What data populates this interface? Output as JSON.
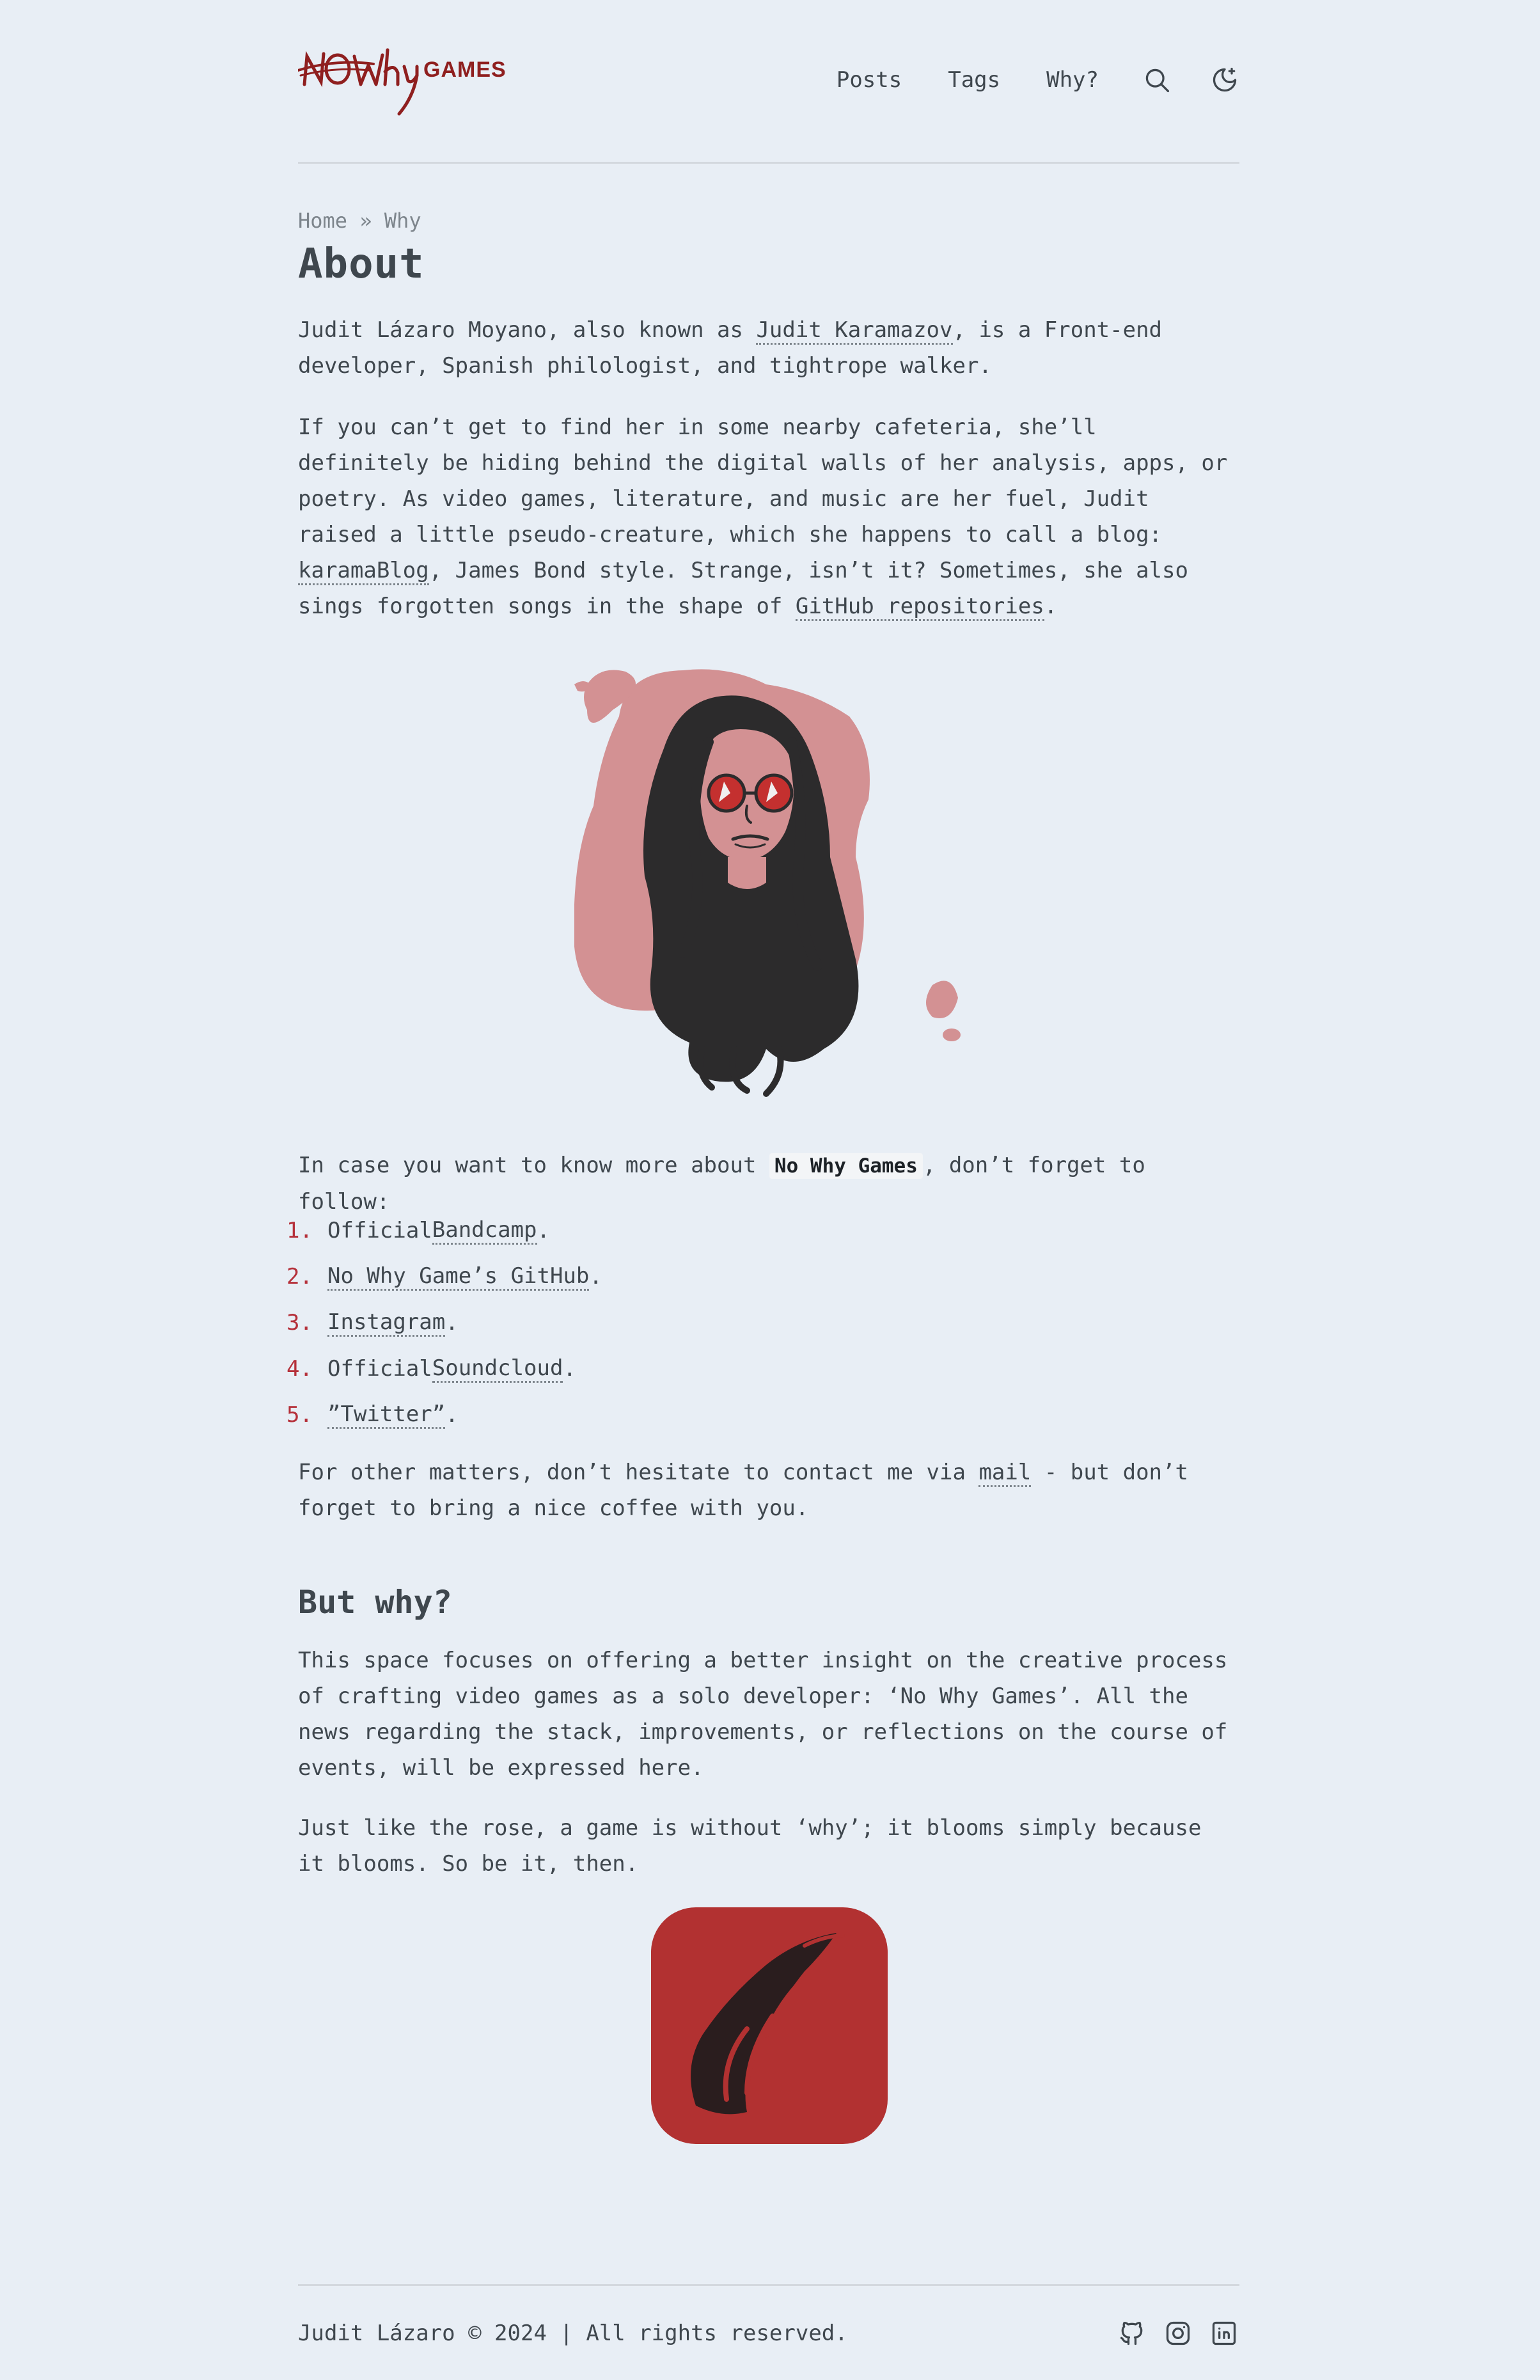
{
  "site": {
    "logo_games": "GAMES",
    "nav": [
      "Posts",
      "Tags",
      "Why?"
    ],
    "icons": {
      "search": "search-icon",
      "theme": "moon-sparkle-icon"
    },
    "accent": "#8f1f1f"
  },
  "breadcrumb": {
    "home": "Home",
    "sep": "»",
    "current": "Why"
  },
  "page_title": "About",
  "intro": {
    "p1_before": "Judit Lázaro Moyano, also known as ",
    "p1_link": "Judit Karamazov",
    "p1_after": ", is a Front-end developer, Spanish philologist, and tightrope walker.",
    "p2_before": "If you can’t get to find her in some nearby cafeteria, she’ll definitely be hiding behind the digital walls of her analysis, apps, or poetry. As video games, literature, and music are her fuel, Judit raised a little pseudo-creature, which she happens to call a blog: ",
    "p2_link1": "karamaBlog",
    "p2_mid": ", James Bond style. Strange, isn’t it? Sometimes, she also sings forgotten songs in the shape of ",
    "p2_link2": "GitHub repositories",
    "p2_after": "."
  },
  "follow": {
    "before": "In case you want to know more about ",
    "chip": "No Why Games",
    "after": ", don’t forget to follow:",
    "items": [
      {
        "num": "1.",
        "pre": "Official ",
        "link": "Bandcamp",
        "post": "."
      },
      {
        "num": "2.",
        "pre": "",
        "link": "No Why Game’s GitHub",
        "post": "."
      },
      {
        "num": "3.",
        "pre": "",
        "link": "Instagram",
        "post": "."
      },
      {
        "num": "4.",
        "pre": "Official ",
        "link": "Soundcloud",
        "post": "."
      },
      {
        "num": "5.",
        "pre": "",
        "link": "”Twitter”",
        "post": "."
      }
    ]
  },
  "contact": {
    "before": "For other matters, don’t hesitate to contact me via ",
    "link": "mail",
    "after": " - but don’t forget to bring a nice coffee with you."
  },
  "why": {
    "heading": "But why?",
    "p1": "This space focuses on offering a better insight on the creative process of crafting video games as a solo developer: ‘No Why Games’. All the news regarding the stack, improvements, or reflections on the course of events, will be expressed here.",
    "p2": "Just like the rose, a game is without ‘why’; it blooms simply because it blooms. So be it, then."
  },
  "footer": {
    "text": "Judit Lázaro © 2024 | All rights reserved.",
    "icons": [
      "github-icon",
      "instagram-icon",
      "linkedin-icon"
    ]
  }
}
